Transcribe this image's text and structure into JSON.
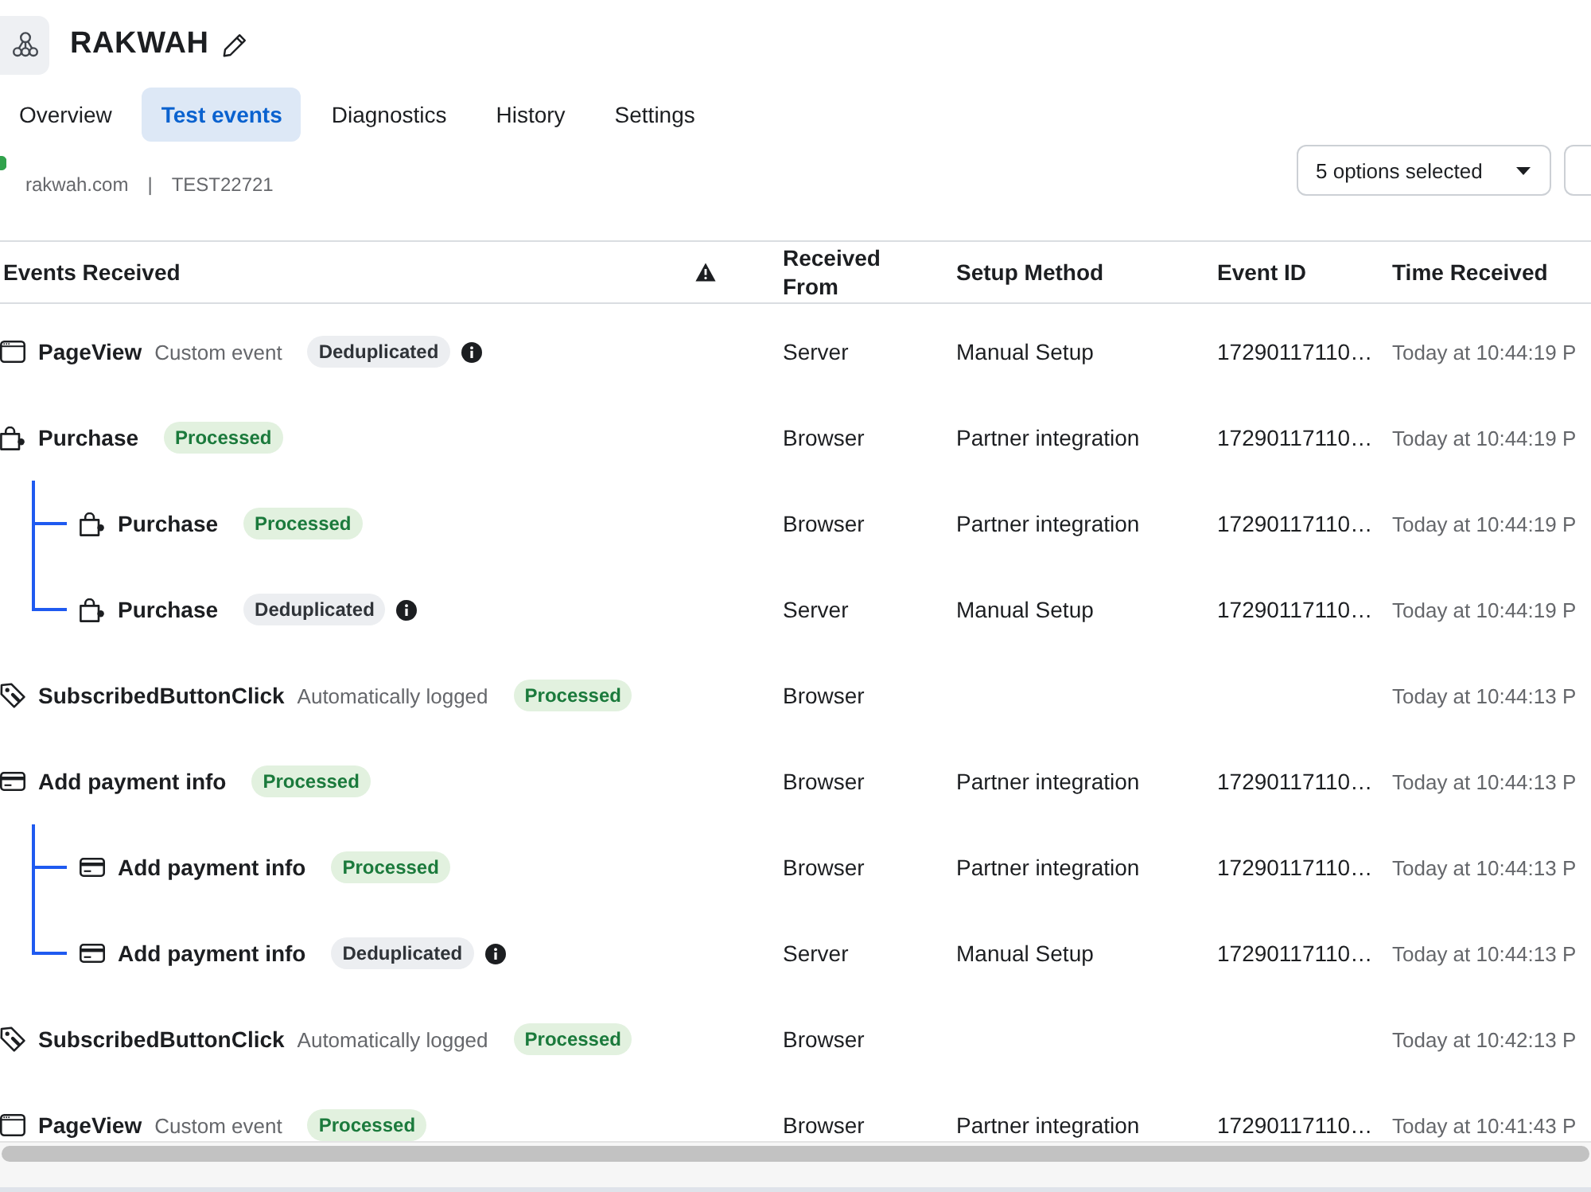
{
  "header": {
    "title": "RAKWAH"
  },
  "tabs": [
    {
      "label": "Overview",
      "selected": false
    },
    {
      "label": "Test events",
      "selected": true
    },
    {
      "label": "Diagnostics",
      "selected": false
    },
    {
      "label": "History",
      "selected": false
    },
    {
      "label": "Settings",
      "selected": false
    }
  ],
  "source": {
    "domain": "rakwah.com",
    "separator": "|",
    "test_code": "TEST22721"
  },
  "filter": {
    "value": "5 options selected"
  },
  "table": {
    "columns": [
      "Events Received",
      "Received From",
      "Setup Method",
      "Event ID",
      "Time Received"
    ],
    "rows": [
      {
        "kind": "pageview",
        "name": "PageView",
        "type": "Custom event",
        "status": {
          "label": "Deduplicated",
          "kind": "deduplicated"
        },
        "info": true,
        "received_from": "Server",
        "setup_method": "Manual Setup",
        "event_id": "17290117110…",
        "time": "Today at 10:44:19 P"
      },
      {
        "kind": "purchase",
        "name": "Purchase",
        "status": {
          "label": "Processed",
          "kind": "processed"
        },
        "info": false,
        "received_from": "Browser",
        "setup_method": "Partner integration",
        "event_id": "17290117110…",
        "time": "Today at 10:44:19 P",
        "children": [
          {
            "kind": "purchase",
            "name": "Purchase",
            "status": {
              "label": "Processed",
              "kind": "processed"
            },
            "info": false,
            "received_from": "Browser",
            "setup_method": "Partner integration",
            "event_id": "17290117110…",
            "time": "Today at 10:44:19 P"
          },
          {
            "kind": "purchase",
            "name": "Purchase",
            "status": {
              "label": "Deduplicated",
              "kind": "deduplicated"
            },
            "info": true,
            "received_from": "Server",
            "setup_method": "Manual Setup",
            "event_id": "17290117110…",
            "time": "Today at 10:44:19 P"
          }
        ]
      },
      {
        "kind": "click",
        "name": "SubscribedButtonClick",
        "type": "Automatically logged",
        "status": {
          "label": "Processed",
          "kind": "processed"
        },
        "info": false,
        "received_from": "Browser",
        "time": "Today at 10:44:13 P"
      },
      {
        "kind": "payment",
        "name": "Add payment info",
        "status": {
          "label": "Processed",
          "kind": "processed"
        },
        "info": false,
        "received_from": "Browser",
        "setup_method": "Partner integration",
        "event_id": "17290117110…",
        "time": "Today at 10:44:13 P",
        "children": [
          {
            "kind": "payment",
            "name": "Add payment info",
            "status": {
              "label": "Processed",
              "kind": "processed"
            },
            "info": false,
            "received_from": "Browser",
            "setup_method": "Partner integration",
            "event_id": "17290117110…",
            "time": "Today at 10:44:13 P"
          },
          {
            "kind": "payment",
            "name": "Add payment info",
            "status": {
              "label": "Deduplicated",
              "kind": "deduplicated"
            },
            "info": true,
            "received_from": "Server",
            "setup_method": "Manual Setup",
            "event_id": "17290117110…",
            "time": "Today at 10:44:13 P"
          }
        ]
      },
      {
        "kind": "click",
        "name": "SubscribedButtonClick",
        "type": "Automatically logged",
        "status": {
          "label": "Processed",
          "kind": "processed"
        },
        "info": false,
        "received_from": "Browser",
        "time": "Today at 10:42:13 P"
      },
      {
        "kind": "pageview",
        "name": "PageView",
        "type": "Custom event",
        "status": {
          "label": "Processed",
          "kind": "processed"
        },
        "info": false,
        "received_from": "Browser",
        "setup_method": "Partner integration",
        "event_id": "17290117110…",
        "time": "Today at 10:41:43 P"
      }
    ]
  }
}
